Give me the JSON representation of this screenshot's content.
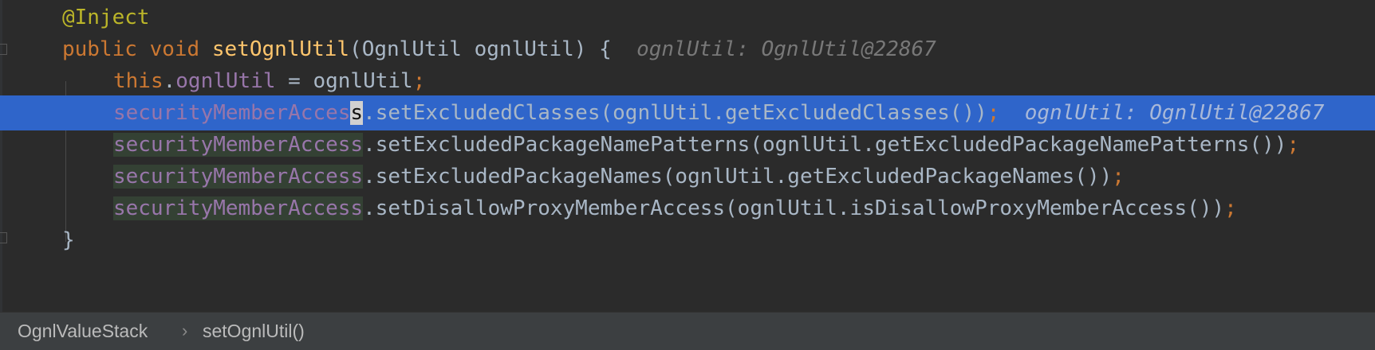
{
  "editor": {
    "lines": {
      "l1": {
        "anno": "@Inject"
      },
      "l2": {
        "kw_public": "public",
        "kw_void": "void",
        "method": "setOgnlUtil",
        "params": "(OgnlUtil ognlUtil) {",
        "hint": "ognlUtil: OgnlUtil@22867"
      },
      "l3": {
        "kw_this": "this",
        "dot": ".",
        "field": "ognlUtil",
        "rest": " = ognlUtil",
        "semi": ";"
      },
      "l4": {
        "field_a": "securityMemberAcces",
        "caret_char": "s",
        "call": ".setExcludedClasses(ognlUtil.getExcludedClasses())",
        "semi": ";",
        "hint": "ognlUtil: OgnlUtil@22867"
      },
      "l5": {
        "field": "securityMemberAccess",
        "call": ".setExcludedPackageNamePatterns(ognlUtil.getExcludedPackageNamePatterns())",
        "semi": ";"
      },
      "l6": {
        "field": "securityMemberAccess",
        "call": ".setExcludedPackageNames(ognlUtil.getExcludedPackageNames())",
        "semi": ";"
      },
      "l7": {
        "field": "securityMemberAccess",
        "call": ".setDisallowProxyMemberAccess(ognlUtil.isDisallowProxyMemberAccess())",
        "semi": ";"
      },
      "l8": {
        "brace": "}"
      }
    }
  },
  "breadcrumb": {
    "class_name": "OgnlValueStack",
    "separator": "›",
    "method_name": "setOgnlUtil()"
  },
  "colors": {
    "background": "#2b2b2b",
    "keyword": "#cc7832",
    "annotation": "#bbb529",
    "method": "#ffc66d",
    "field": "#9876aa",
    "text": "#a9b7c6",
    "selection": "#2f65ca",
    "breadcrumb_bar": "#3c3f41"
  }
}
